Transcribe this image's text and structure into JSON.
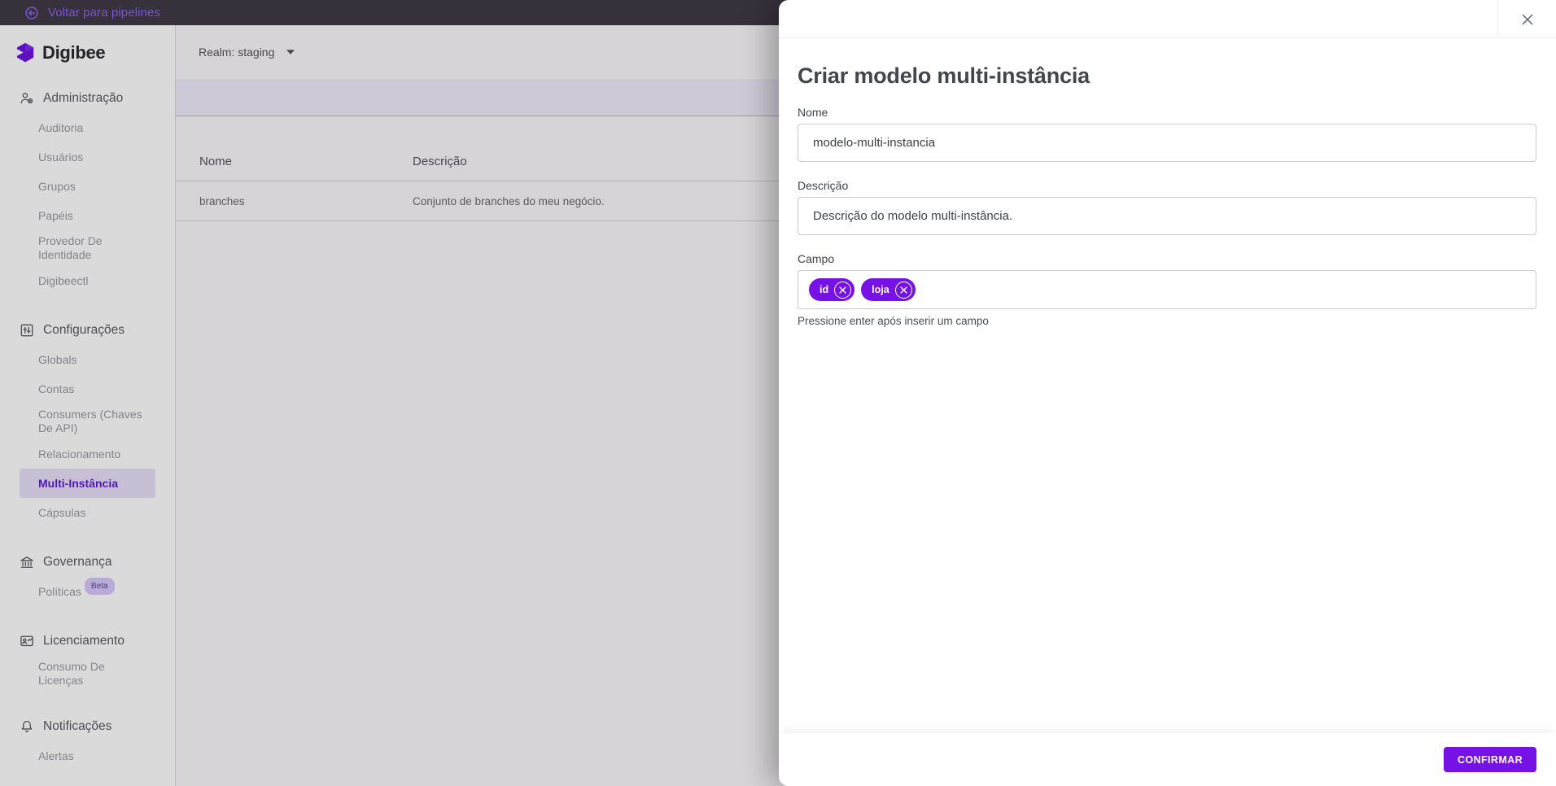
{
  "topbar": {
    "back_label": "Voltar para pipelines"
  },
  "brand": {
    "name": "Digibee"
  },
  "sidebar": {
    "sections": [
      {
        "label": "Administração",
        "icon": "admin-user-icon",
        "items": [
          {
            "label": "Auditoria"
          },
          {
            "label": "Usuários"
          },
          {
            "label": "Grupos"
          },
          {
            "label": "Papéis"
          },
          {
            "label": "Provedor De Identidade"
          },
          {
            "label": "Digibeectl"
          }
        ]
      },
      {
        "label": "Configurações",
        "icon": "settings-panel-icon",
        "items": [
          {
            "label": "Globals"
          },
          {
            "label": "Contas"
          },
          {
            "label": "Consumers (Chaves De API)"
          },
          {
            "label": "Relacionamento"
          },
          {
            "label": "Multi-Instância",
            "active": true
          },
          {
            "label": "Cápsulas"
          }
        ]
      },
      {
        "label": "Governança",
        "icon": "bank-icon",
        "items": [
          {
            "label": "Políticas",
            "badge": "Beta"
          }
        ]
      },
      {
        "label": "Licenciamento",
        "icon": "license-window-icon",
        "items": [
          {
            "label": "Consumo De Licenças"
          }
        ]
      },
      {
        "label": "Notificações",
        "icon": "bell-icon",
        "items": [
          {
            "label": "Alertas"
          }
        ]
      }
    ]
  },
  "main": {
    "realm_label": "Realm: staging",
    "table": {
      "columns": {
        "nome": "Nome",
        "descricao": "Descrição"
      },
      "rows": [
        {
          "nome": "branches",
          "descricao": "Conjunto de branches do meu negócio."
        }
      ]
    }
  },
  "modal": {
    "title": "Criar modelo multi-instância",
    "fields": {
      "nome": {
        "label": "Nome",
        "value": "modelo-multi-instancia"
      },
      "descricao": {
        "label": "Descrição",
        "value": "Descrição do modelo multi-instância."
      },
      "campo": {
        "label": "Campo",
        "chips": [
          {
            "label": "id"
          },
          {
            "label": "loja"
          }
        ],
        "helper": "Pressione enter após inserir um campo"
      }
    },
    "confirm_label": "CONFIRMAR"
  },
  "colors": {
    "brand_purple": "#7612e6",
    "active_purple": "#5e1cd6",
    "link_purple": "#8f5ffa",
    "topbar_bg": "#403a44",
    "toolbar_lavender": "#efecf9"
  }
}
